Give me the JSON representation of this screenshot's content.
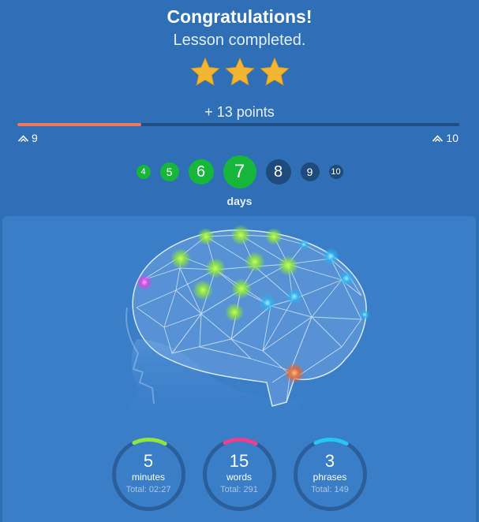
{
  "header": {
    "title": "Congratulations!",
    "subtitle": "Lesson completed.",
    "stars_earned": 3,
    "points": "+ 13 points"
  },
  "progress": {
    "fraction": 0.28,
    "level_from": "9",
    "level_to": "10"
  },
  "streak": {
    "days": [
      {
        "label": "4",
        "state": "done",
        "size": "xs"
      },
      {
        "label": "5",
        "state": "done",
        "size": "sm"
      },
      {
        "label": "6",
        "state": "done",
        "size": "md"
      },
      {
        "label": "7",
        "state": "done",
        "size": "lg"
      },
      {
        "label": "8",
        "state": "todo",
        "size": "md"
      },
      {
        "label": "9",
        "state": "todo",
        "size": "sm"
      },
      {
        "label": "10",
        "state": "todo",
        "size": "xs"
      }
    ],
    "label": "days"
  },
  "stats": [
    {
      "value": "5",
      "label": "minutes",
      "total": "Total: 02:27",
      "color": "#8ee63c"
    },
    {
      "value": "15",
      "label": "words",
      "total": "Total: 291",
      "color": "#ec3f8e"
    },
    {
      "value": "3",
      "label": "phrases",
      "total": "Total: 149",
      "color": "#26c6f0"
    }
  ],
  "colors": {
    "background": "#2f6fb5",
    "panel": "#3a7ec8",
    "accent_progress": "#f07860",
    "streak_done": "#15b63a",
    "streak_todo": "#1f4a7c",
    "star": "#f2b632"
  }
}
